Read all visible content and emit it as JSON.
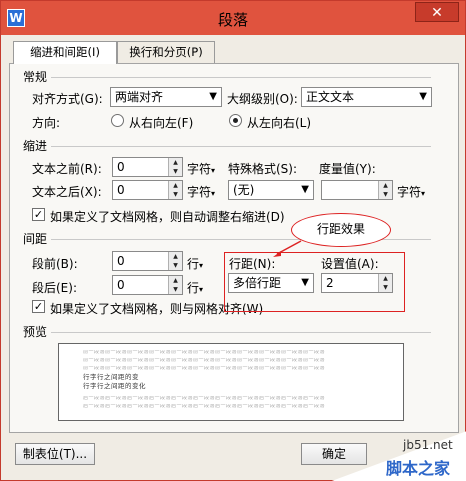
{
  "window": {
    "title": "段落",
    "icon": "wps-writer-icon"
  },
  "tabs": [
    {
      "label": "缩进和间距(I)"
    },
    {
      "label": "换行和分页(P)"
    }
  ],
  "general": {
    "section": "常规",
    "align_label": "对齐方式(G):",
    "align_value": "两端对齐",
    "outline_label": "大纲级别(O):",
    "outline_value": "正文文本",
    "direction_label": "方向:",
    "rtl_label": "从右向左(F)",
    "ltr_label": "从左向右(L)"
  },
  "indent": {
    "section": "缩进",
    "before_label": "文本之前(R):",
    "before_value": "0",
    "before_unit": "字符",
    "special_label": "特殊格式(S):",
    "special_value": "(无)",
    "measure_label": "度量值(Y):",
    "measure_value": "",
    "measure_unit": "字符",
    "after_label": "文本之后(X):",
    "after_value": "0",
    "after_unit": "字符",
    "auto_adjust_label": "如果定义了文档网格，则自动调整右缩进(D)"
  },
  "spacing": {
    "section": "间距",
    "before_label": "段前(B):",
    "before_value": "0",
    "before_unit": "行",
    "after_label": "段后(E):",
    "after_value": "0",
    "after_unit": "行",
    "line_label": "行距(N):",
    "line_value": "多倍行距",
    "set_label": "设置值(A):",
    "set_value": "2",
    "grid_label": "如果定义了文档网格，则与网格对齐(W)"
  },
  "callout": {
    "text": "行距效果"
  },
  "preview": {
    "section": "预览",
    "prev_text": "前一段落前一段落前一段落前一段落前一段落前一段落前一段落前一段落前一段落前一段落前一段落",
    "sample_text": "行字行之间距的变",
    "sample_text_full": "行字行之间距的变化",
    "next_text": "后一段落后一段落后一段落后一段落后一段落后一段落后一段落后一段落后一段落后一段落后一段落"
  },
  "buttons": {
    "tabs": "制表位(T)...",
    "ok": "确定"
  },
  "watermark": {
    "site": "jb51.net",
    "logo": "脚本之家"
  },
  "colors": {
    "titlebar": "#e0533e",
    "highlight": "#dd2222",
    "watermark_logo": "#2e67c9"
  }
}
